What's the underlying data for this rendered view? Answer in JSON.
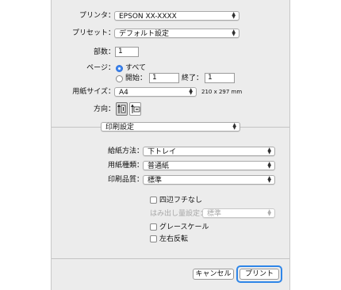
{
  "printer": {
    "label": "プリンタ：",
    "value": "EPSON XX-XXXX"
  },
  "presets": {
    "label": "プリセット：",
    "value": "デフォルト設定"
  },
  "copies": {
    "label": "部数：",
    "value": "1"
  },
  "pages": {
    "label": "ページ：",
    "all_label": "すべて",
    "from_label": "開始：",
    "from_value": "1",
    "to_label": "終了：",
    "to_value": "1",
    "selected": "all"
  },
  "paper_size": {
    "label": "用紙サイズ：",
    "value": "A4",
    "dimensions": "210 x 297 mm"
  },
  "orientation": {
    "label": "方向：",
    "selected": "portrait"
  },
  "section": {
    "value": "印刷設定"
  },
  "print_settings": {
    "paper_source": {
      "label": "給紙方法：",
      "value": "下トレイ"
    },
    "media_type": {
      "label": "用紙種類：",
      "value": "普通紙"
    },
    "print_quality": {
      "label": "印刷品質：",
      "value": "標準"
    }
  },
  "options": {
    "borderless": {
      "label": "四辺フチなし",
      "checked": false
    },
    "expansion": {
      "label": "はみ出し量設定：",
      "value": "標準",
      "enabled": false
    },
    "grayscale": {
      "label": "グレースケール",
      "checked": false
    },
    "mirror": {
      "label": "左右反転",
      "checked": false
    }
  },
  "buttons": {
    "cancel": "キャンセル",
    "print": "プリント"
  },
  "colors": {
    "accent": "#2f86e8",
    "panel": "#ececec"
  }
}
